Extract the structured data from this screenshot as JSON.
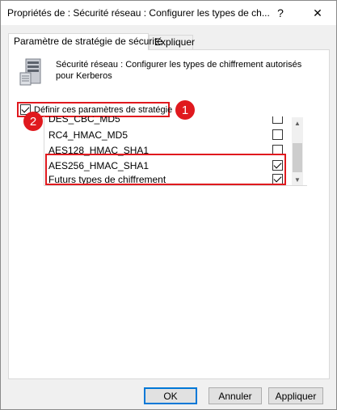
{
  "window": {
    "title": "Propriétés de : Sécurité réseau : Configurer les types de ch...",
    "help_glyph": "?",
    "close_glyph": "✕"
  },
  "tabs": [
    {
      "label": "Paramètre de stratégie de sécurité",
      "active": true
    },
    {
      "label": "Expliquer",
      "active": false
    }
  ],
  "policy": {
    "icon": "server-policy-icon",
    "description": "Sécurité réseau : Configurer les types de chiffrement autorisés pour Kerberos"
  },
  "define_checkbox": {
    "label": "Définir ces paramètres de stratégie",
    "checked": true
  },
  "callouts": {
    "one": "1",
    "two": "2"
  },
  "encryption_types": [
    {
      "label": "DES_CBC_MD5",
      "checked": false
    },
    {
      "label": "RC4_HMAC_MD5",
      "checked": false
    },
    {
      "label": "AES128_HMAC_SHA1",
      "checked": false
    },
    {
      "label": "AES256_HMAC_SHA1",
      "checked": true
    },
    {
      "label": "Futurs types de chiffrement",
      "checked": true
    }
  ],
  "scrollbar": {
    "up_glyph": "▲",
    "down_glyph": "▼"
  },
  "buttons": {
    "ok": "OK",
    "cancel": "Annuler",
    "apply": "Appliquer"
  },
  "colors": {
    "annotation_red": "#e0191e",
    "dialog_bg": "#f0f0f0",
    "panel_bg": "#ffffff"
  }
}
